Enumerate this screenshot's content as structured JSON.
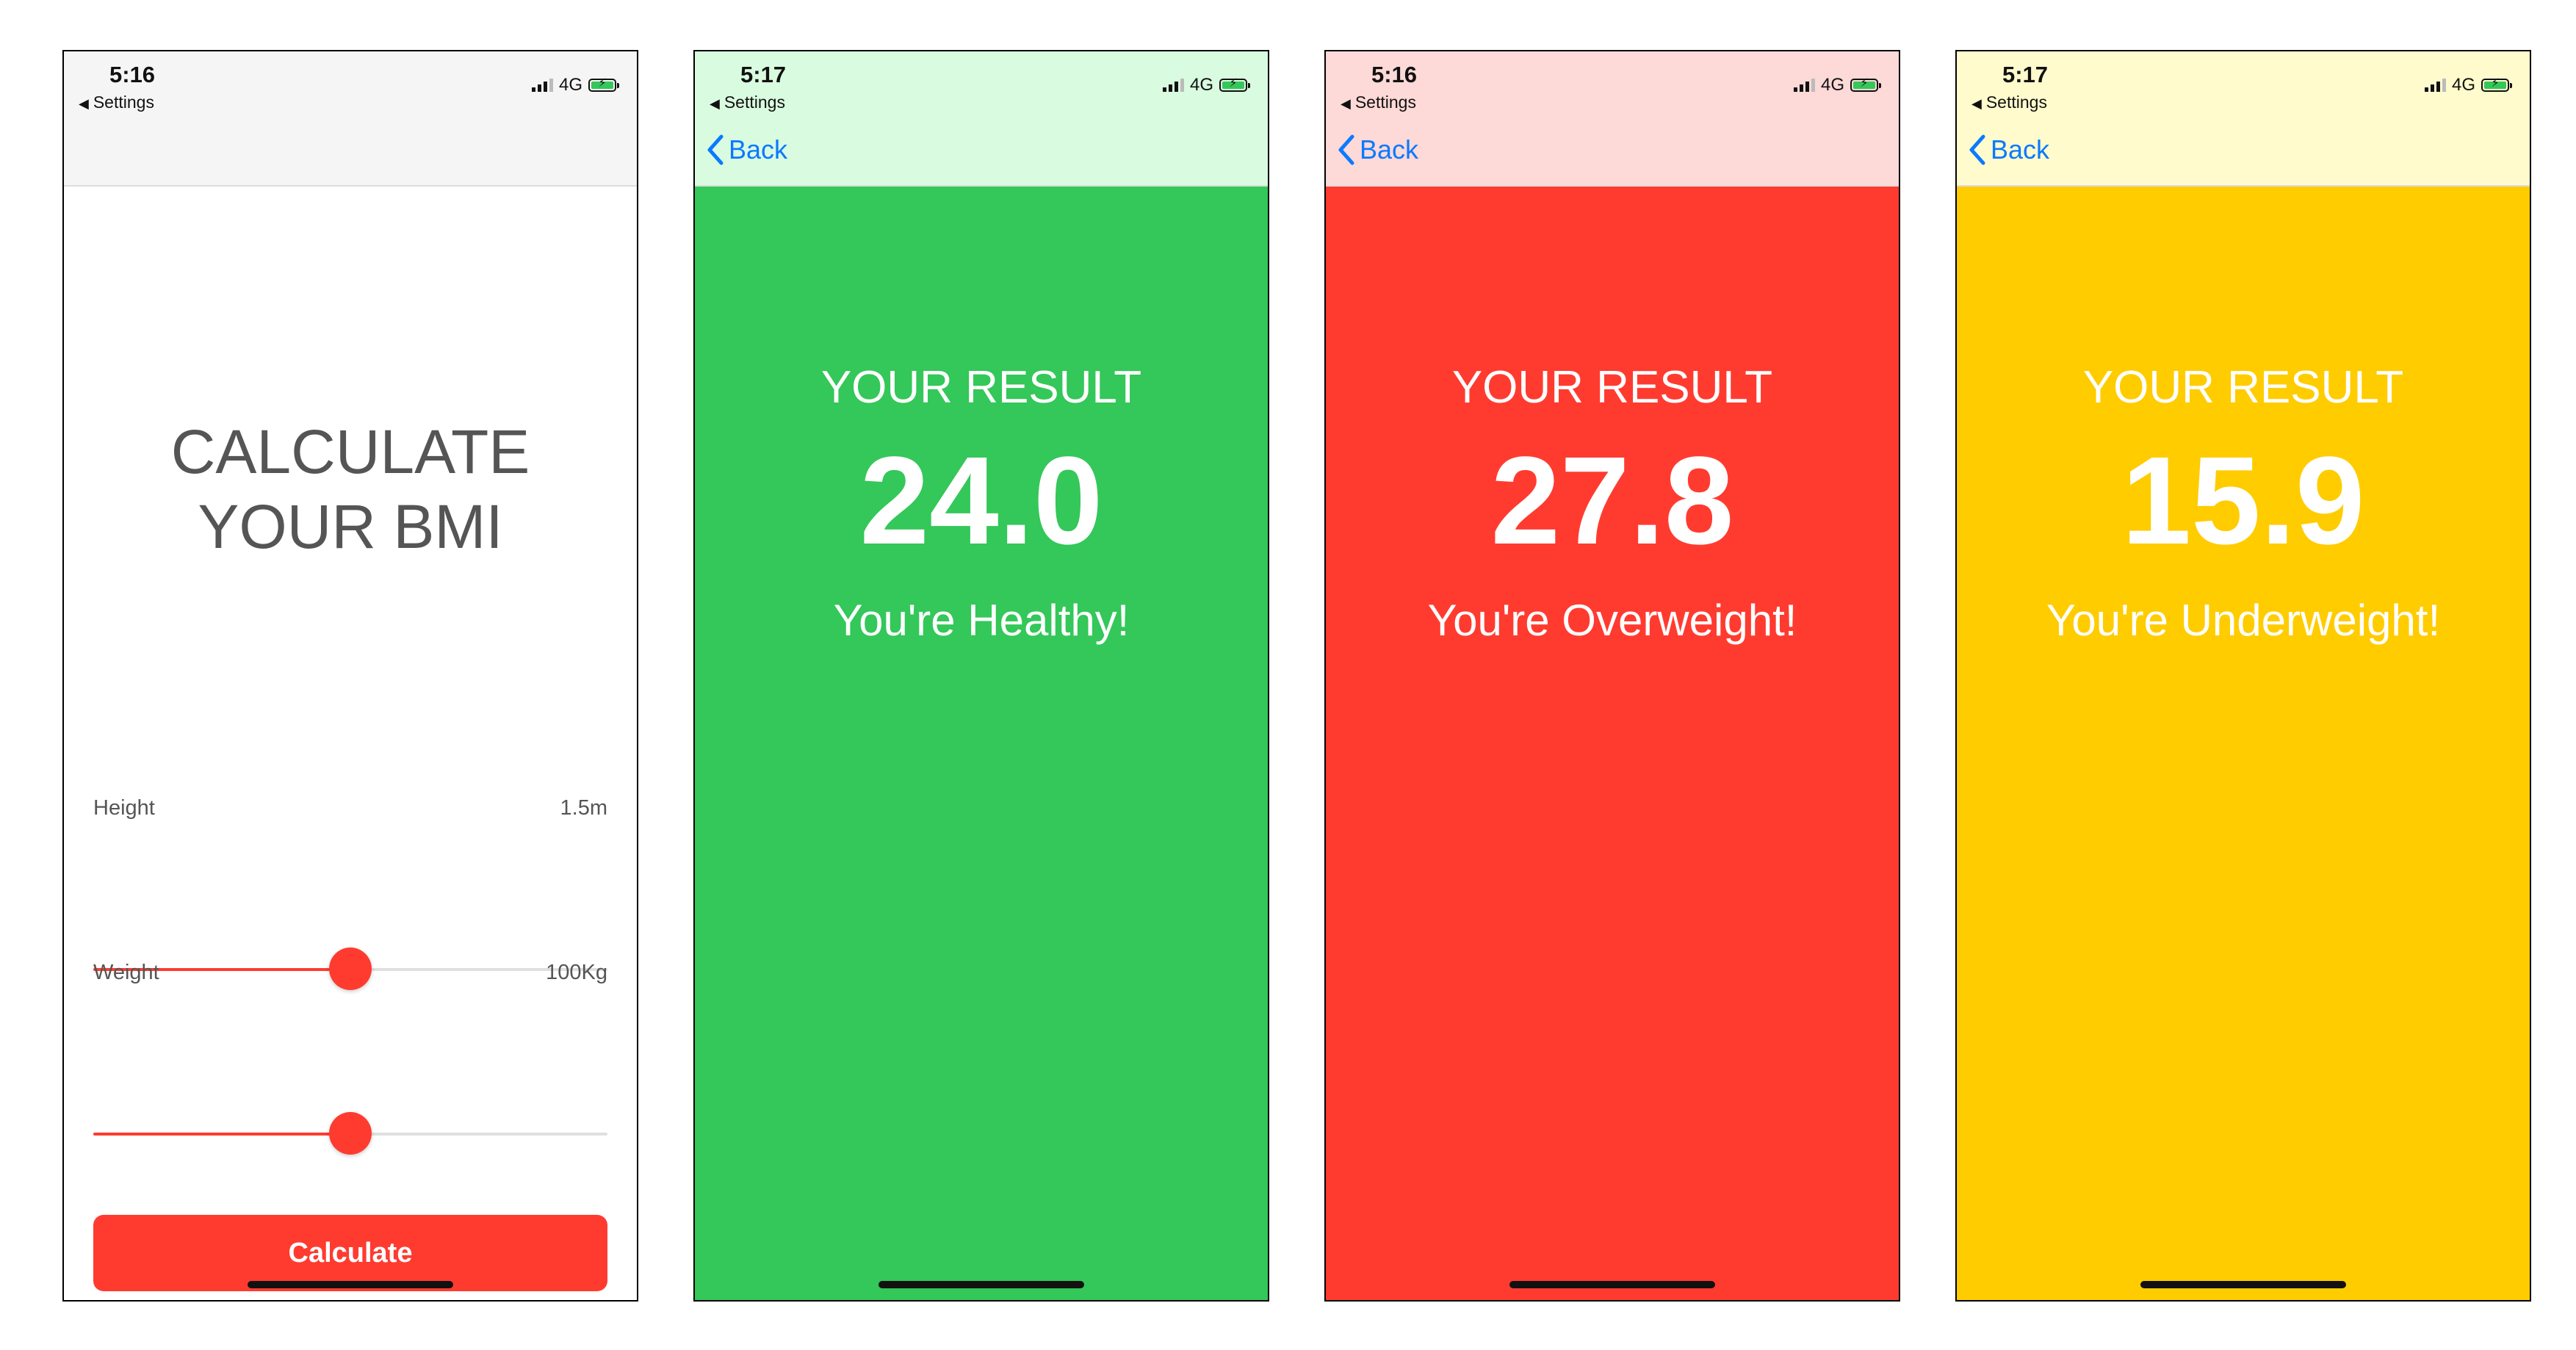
{
  "screens": [
    {
      "status": {
        "time": "5:16",
        "back_label": "Settings",
        "network": "4G"
      },
      "header_color": "#f5f5f5",
      "title_line1": "CALCULATE",
      "title_line2": "YOUR BMI",
      "height": {
        "label": "Height",
        "value": "1.5m",
        "slider_fraction": 0.5
      },
      "weight": {
        "label": "Weight",
        "value": "100Kg",
        "slider_fraction": 0.5
      },
      "calculate_label": "Calculate"
    },
    {
      "status": {
        "time": "5:17",
        "back_label": "Settings",
        "network": "4G"
      },
      "header_color": "#d9fbe0",
      "background_color": "#34c759",
      "back_label": "Back",
      "heading": "YOUR RESULT",
      "bmi": "24.0",
      "advice": "You're Healthy!"
    },
    {
      "status": {
        "time": "5:16",
        "back_label": "Settings",
        "network": "4G"
      },
      "header_color": "#fdd9d7",
      "background_color": "#ff3b30",
      "back_label": "Back",
      "heading": "YOUR RESULT",
      "bmi": "27.8",
      "advice": "You're Overweight!"
    },
    {
      "status": {
        "time": "5:17",
        "back_label": "Settings",
        "network": "4G"
      },
      "header_color": "#fffbcc",
      "background_color": "#ffcc00",
      "back_label": "Back",
      "heading": "YOUR RESULT",
      "bmi": "15.9",
      "advice": "You're Underweight!"
    }
  ],
  "colors": {
    "accent_red": "#ff3b30",
    "link_blue": "#0a7aff"
  },
  "icons": {
    "back": "chevron-left-icon",
    "signal": "cellular-signal-icon",
    "battery": "battery-charging-icon"
  }
}
